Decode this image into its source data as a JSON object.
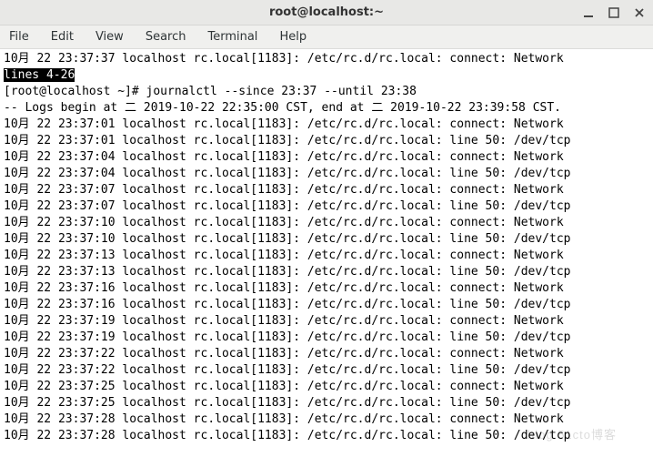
{
  "window": {
    "title": "root@localhost:~"
  },
  "menubar": {
    "items": [
      "File",
      "Edit",
      "View",
      "Search",
      "Terminal",
      "Help"
    ]
  },
  "term": {
    "top_line": "10月 22 23:37:37 localhost rc.local[1183]: /etc/rc.d/rc.local: connect: Network ",
    "highlight": "lines 4-26",
    "prompt_full": "[root@localhost ~]# journalctl --since 23:37 --until 23:38",
    "logs_header": "-- Logs begin at 二 2019-10-22 22:35:00 CST, end at 二 2019-10-22 23:39:58 CST. ",
    "rows": [
      "10月 22 23:37:01 localhost rc.local[1183]: /etc/rc.d/rc.local: connect: Network ",
      "10月 22 23:37:01 localhost rc.local[1183]: /etc/rc.d/rc.local: line 50: /dev/tcp",
      "10月 22 23:37:04 localhost rc.local[1183]: /etc/rc.d/rc.local: connect: Network ",
      "10月 22 23:37:04 localhost rc.local[1183]: /etc/rc.d/rc.local: line 50: /dev/tcp",
      "10月 22 23:37:07 localhost rc.local[1183]: /etc/rc.d/rc.local: connect: Network ",
      "10月 22 23:37:07 localhost rc.local[1183]: /etc/rc.d/rc.local: line 50: /dev/tcp",
      "10月 22 23:37:10 localhost rc.local[1183]: /etc/rc.d/rc.local: connect: Network ",
      "10月 22 23:37:10 localhost rc.local[1183]: /etc/rc.d/rc.local: line 50: /dev/tcp",
      "10月 22 23:37:13 localhost rc.local[1183]: /etc/rc.d/rc.local: connect: Network ",
      "10月 22 23:37:13 localhost rc.local[1183]: /etc/rc.d/rc.local: line 50: /dev/tcp",
      "10月 22 23:37:16 localhost rc.local[1183]: /etc/rc.d/rc.local: connect: Network ",
      "10月 22 23:37:16 localhost rc.local[1183]: /etc/rc.d/rc.local: line 50: /dev/tcp",
      "10月 22 23:37:19 localhost rc.local[1183]: /etc/rc.d/rc.local: connect: Network ",
      "10月 22 23:37:19 localhost rc.local[1183]: /etc/rc.d/rc.local: line 50: /dev/tcp",
      "10月 22 23:37:22 localhost rc.local[1183]: /etc/rc.d/rc.local: connect: Network ",
      "10月 22 23:37:22 localhost rc.local[1183]: /etc/rc.d/rc.local: line 50: /dev/tcp",
      "10月 22 23:37:25 localhost rc.local[1183]: /etc/rc.d/rc.local: connect: Network ",
      "10月 22 23:37:25 localhost rc.local[1183]: /etc/rc.d/rc.local: line 50: /dev/tcp",
      "10月 22 23:37:28 localhost rc.local[1183]: /etc/rc.d/rc.local: connect: Network ",
      "10月 22 23:37:28 localhost rc.local[1183]: /etc/rc.d/rc.local: line 50: /dev/tcp"
    ],
    "watermark": "blog.51cto博客"
  }
}
